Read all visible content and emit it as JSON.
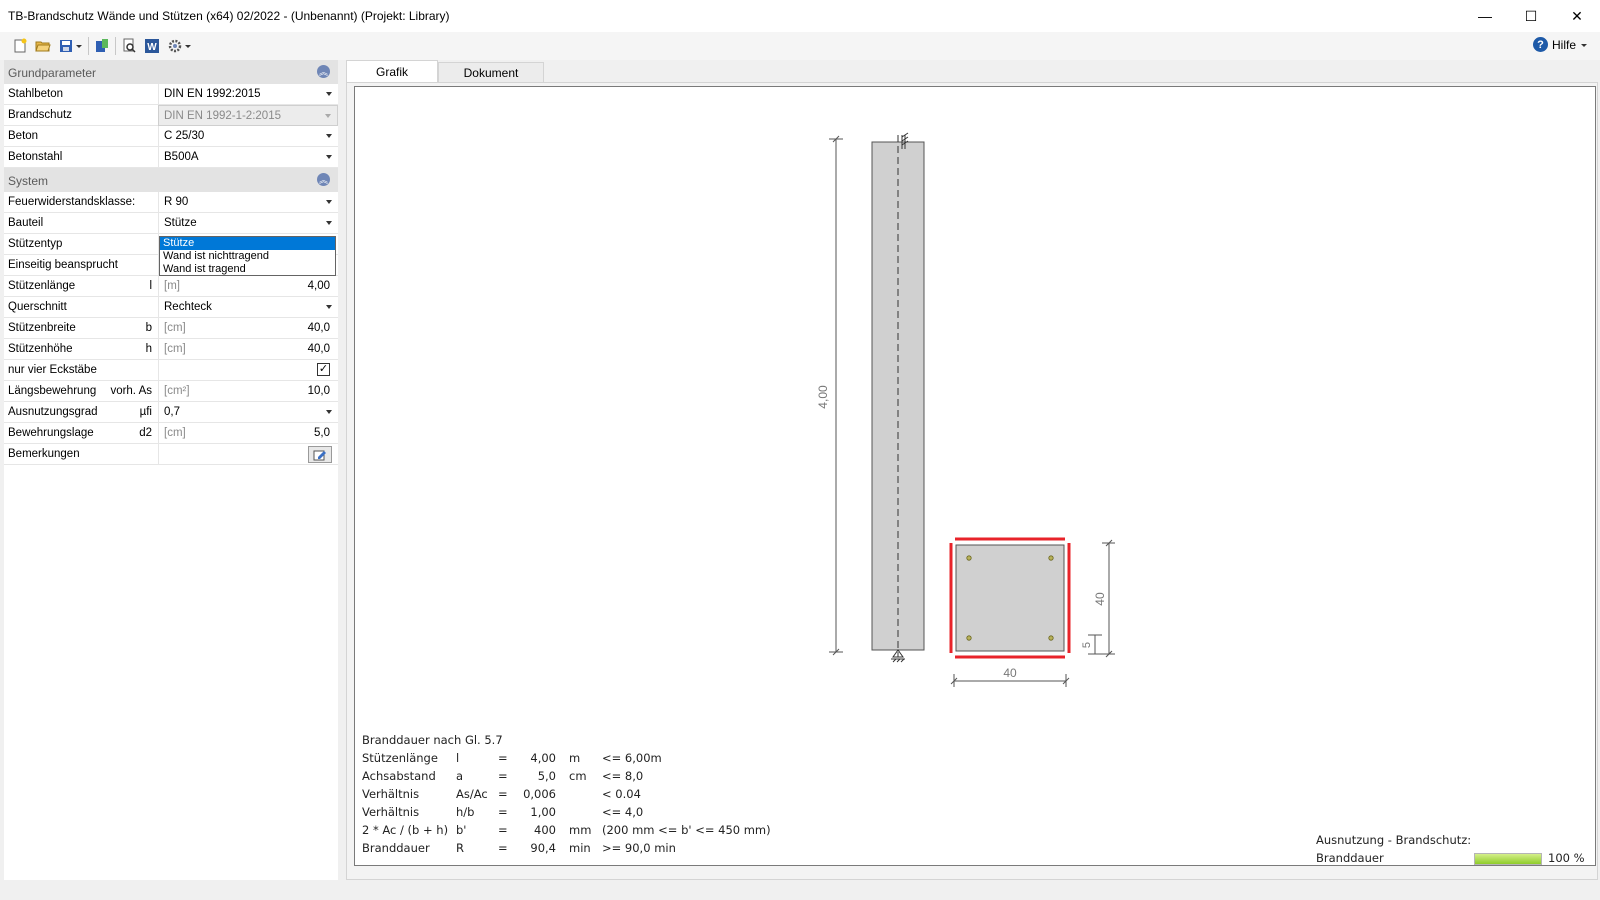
{
  "window": {
    "title": "TB-Brandschutz Wände und Stützen (x64) 02/2022 - (Unbenannt) (Projekt: Library)",
    "minimize": "—",
    "maximize": "☐",
    "close": "✕"
  },
  "toolbar": {
    "icons": [
      "new-file-icon",
      "open-folder-icon",
      "save-icon",
      "save-dropdown-icon",
      "export-icon",
      "print-preview-icon",
      "word-icon",
      "settings-icon"
    ],
    "help_label": "Hilfe",
    "help_glyph": "?",
    "word_glyph": "W"
  },
  "panel": {
    "grund": {
      "title": "Grundparameter",
      "rows": [
        {
          "label": "Stahlbeton",
          "value": "DIN EN 1992:2015"
        },
        {
          "label": "Brandschutz",
          "value": "DIN EN 1992-1-2:2015"
        },
        {
          "label": "Beton",
          "value": "C 25/30"
        },
        {
          "label": "Betonstahl",
          "value": "B500A"
        }
      ]
    },
    "system": {
      "title": "System",
      "rows": [
        {
          "label": "Feuerwiderstandsklasse:",
          "value": "R  90"
        },
        {
          "label": "Bauteil",
          "value": "Stütze"
        },
        {
          "label": "Stützentyp"
        },
        {
          "label": "Einseitig beansprucht"
        },
        {
          "label": "Stützenlänge",
          "symbol": "l",
          "unit": "[m]",
          "value": "4,00"
        },
        {
          "label": "Querschnitt",
          "value": "Rechteck"
        },
        {
          "label": "Stützenbreite",
          "symbol": "b",
          "unit": "[cm]",
          "value": "40,0"
        },
        {
          "label": "Stützenhöhe",
          "symbol": "h",
          "unit": "[cm]",
          "value": "40,0"
        },
        {
          "label": "nur vier Eckstäbe",
          "check": "✓"
        },
        {
          "label": "Längsbewehrung",
          "symbol": "vorh. As",
          "unit": "[cm²]",
          "value": "10,0"
        },
        {
          "label": "Ausnutzungsgrad",
          "symbol": "µfi",
          "value": "0,7"
        },
        {
          "label": "Bewehrungslage",
          "symbol": "d2",
          "unit": "[cm]",
          "value": "5,0"
        },
        {
          "label": "Bemerkungen"
        }
      ]
    },
    "dropdown_options": [
      "Stütze",
      "Wand ist nichttragend",
      "Wand ist tragend"
    ]
  },
  "tabs": [
    "Grafik",
    "Dokument"
  ],
  "drawing": {
    "length_dim": "4,00",
    "width_dim": "40",
    "height_dim": "40",
    "cover_dim": "5"
  },
  "results": {
    "heading": "Branddauer nach Gl. 5.7",
    "rows": [
      {
        "name": "Stützenlänge",
        "sym": "l",
        "eq": "=",
        "val": "4,00",
        "unit": "m",
        "cond": "<= 6,00m"
      },
      {
        "name": "Achsabstand",
        "sym": "a",
        "eq": "=",
        "val": "5,0",
        "unit": "cm",
        "cond": "<= 8,0"
      },
      {
        "name": "Verhältnis",
        "sym": "As/Ac",
        "eq": "=",
        "val": "0,006",
        "unit": "",
        "cond": "< 0.04"
      },
      {
        "name": "Verhältnis",
        "sym": "h/b",
        "eq": "=",
        "val": "1,00",
        "unit": "",
        "cond": "<= 4,0"
      },
      {
        "name": "2 * Ac / (b + h)",
        "sym": "b'",
        "eq": "=",
        "val": "400",
        "unit": "mm",
        "cond": "(200 mm <= b' <= 450 mm)"
      },
      {
        "name": "Branddauer",
        "sym": "R",
        "eq": "=",
        "val": "90,4",
        "unit": "min",
        "cond": ">= 90,0 min"
      }
    ]
  },
  "utilization": {
    "title": "Ausnutzung - Brandschutz:",
    "label": "Branddauer",
    "value": "100 %",
    "fraction": 1.0,
    "color": "#8fcc2a"
  }
}
